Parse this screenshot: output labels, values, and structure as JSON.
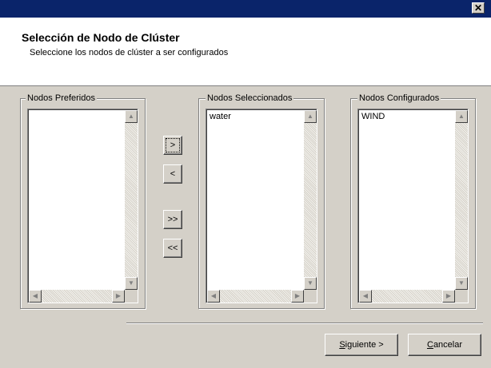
{
  "window": {
    "close_glyph": "✕"
  },
  "header": {
    "title": "Selección de Nodo de Clúster",
    "subtitle": "Seleccione los nodos de clúster a ser configurados"
  },
  "groups": {
    "preferred": {
      "label": "Nodos Preferidos",
      "items": []
    },
    "selected": {
      "label": "Nodos Seleccionados",
      "items": [
        "water"
      ]
    },
    "configured": {
      "label": "Nodos Configurados",
      "items": [
        "WIND"
      ]
    }
  },
  "transfer": {
    "add_one": ">",
    "remove_one": "<",
    "add_all": ">>",
    "remove_all": "<<"
  },
  "footer": {
    "next_access_key": "S",
    "next_rest": "iguiente >",
    "cancel_access_key": "C",
    "cancel_rest": "ancelar"
  },
  "icons": {
    "scroll_up": "▲",
    "scroll_down": "▼",
    "scroll_left": "◀",
    "scroll_right": "▶"
  }
}
